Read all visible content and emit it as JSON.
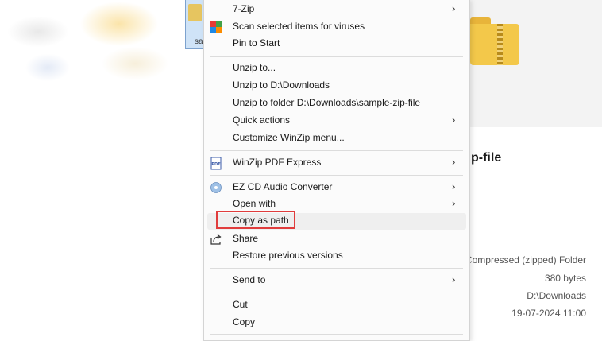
{
  "explorer": {
    "selected_file_name": "sa",
    "preview_title": "p-file",
    "properties": {
      "type": "Compressed (zipped) Folder",
      "size": "380 bytes",
      "location": "D:\\Downloads",
      "date": "19-07-2024 11:00"
    }
  },
  "menu": {
    "items": [
      {
        "label": "7-Zip",
        "submenu": true
      },
      {
        "label": "Scan selected items for viruses",
        "icon": "antivirus-icon"
      },
      {
        "label": "Pin to Start"
      },
      {
        "label": "Unzip to..."
      },
      {
        "label": "Unzip to D:\\Downloads"
      },
      {
        "label": "Unzip to folder D:\\Downloads\\sample-zip-file"
      },
      {
        "label": "Quick actions",
        "submenu": true
      },
      {
        "label": "Customize WinZip menu..."
      },
      {
        "label": "WinZip PDF Express",
        "icon": "pdf-icon",
        "submenu": true
      },
      {
        "label": "EZ CD Audio Converter",
        "icon": "cd-icon",
        "submenu": true
      },
      {
        "label": "Open with",
        "submenu": true
      },
      {
        "label": "Copy as path",
        "highlighted": true
      },
      {
        "label": "Share",
        "icon": "share-icon"
      },
      {
        "label": "Restore previous versions"
      },
      {
        "label": "Send to",
        "submenu": true
      },
      {
        "label": "Cut"
      },
      {
        "label": "Copy"
      }
    ],
    "submenu_arrow": "›",
    "pdf_icon_text": "PDF"
  },
  "colors": {
    "highlight_border": "#e03c3c",
    "menu_background": "#fbfbfb",
    "selection_blue": "#cfe3f7"
  }
}
